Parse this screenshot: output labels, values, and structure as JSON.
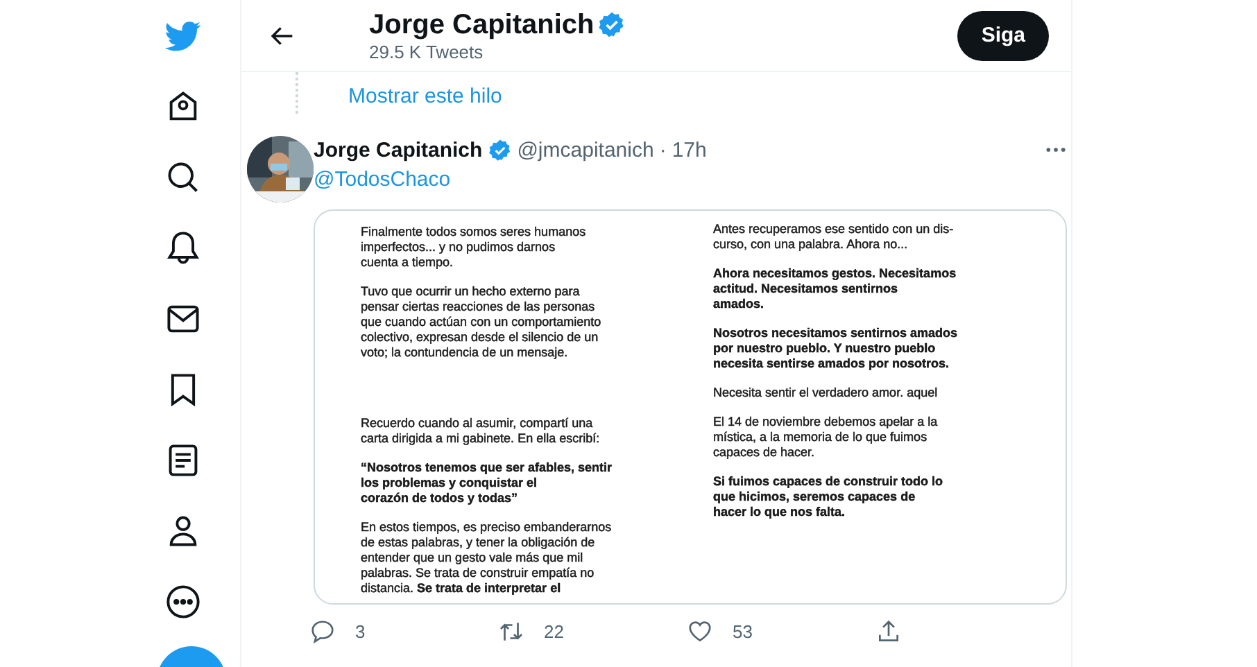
{
  "header": {
    "title": "Jorge Capitanich",
    "verified": true,
    "subtitle": "29.5 K Tweets",
    "follow_button": "Siga"
  },
  "thread_link": "Mostrar este hilo",
  "tweet": {
    "author": "Jorge Capitanich",
    "verified": true,
    "handle": "@jmcapitanich",
    "separator": "·",
    "time": "17h",
    "text": "@TodosChaco",
    "image": {
      "columns": [
        [
          {
            "kind": "regular",
            "lines": [
              "Finalmente todos somos seres humanos",
              "imperfectos... y no pudimos darnos",
              "cuenta a tiempo."
            ]
          },
          {
            "kind": "regular",
            "lines": [
              "Tuvo que ocurrir un hecho externo para",
              "pensar ciertas reacciones de las personas",
              "que cuando actúan con un comportamiento",
              "colectivo, expresan desde el silencio de un",
              "voto; la contundencia de un mensaje."
            ]
          },
          {
            "kind": "regular",
            "lines": [
              "Recuerdo cuando al asumir, compartí una",
              "carta dirigida a mi gabinete. En ella escribí:"
            ]
          },
          {
            "kind": "bold",
            "lines": [
              "“Nosotros tenemos que ser afables, sentir",
              "los problemas y conquistar el",
              "corazón de todos y todas”"
            ]
          },
          {
            "kind": "regular",
            "lines": [
              "En estos tiempos, es preciso embanderarnos",
              "de estas palabras, y tener la obligación de",
              "entender que un gesto vale más que mil",
              "palabras. Se trata de construir empatía no",
              "distancia. **Se trata de interpretar el**"
            ]
          }
        ],
        [
          {
            "kind": "regular",
            "lines": [
              "Antes recuperamos ese sentido con un dis-",
              "curso, con una palabra. Ahora no..."
            ]
          },
          {
            "kind": "bold",
            "lines": [
              "Ahora necesitamos gestos. Necesitamos",
              "actitud. Necesitamos sentirnos",
              "amados."
            ]
          },
          {
            "kind": "bold",
            "lines": [
              "Nosotros necesitamos sentirnos amados",
              "por nuestro pueblo. Y nuestro pueblo",
              "necesita sentirse amados por nosotros."
            ]
          },
          {
            "kind": "regular",
            "lines": [
              "Necesita sentir el verdadero amor. aquel"
            ]
          },
          {
            "kind": "regular",
            "lines": [
              "El 14 de noviembre debemos apelar a la",
              "mística, a la memoria de lo que fuimos",
              "capaces de hacer."
            ]
          },
          {
            "kind": "bold",
            "lines": [
              "Si fuimos capaces de construir todo lo",
              "que hicimos, seremos capaces de",
              "hacer lo que nos falta."
            ]
          }
        ]
      ]
    },
    "actions": [
      {
        "kind": "reply",
        "count": "3"
      },
      {
        "kind": "retweet",
        "count": "22"
      },
      {
        "kind": "like",
        "count": "53"
      },
      {
        "kind": "share"
      }
    ]
  }
}
